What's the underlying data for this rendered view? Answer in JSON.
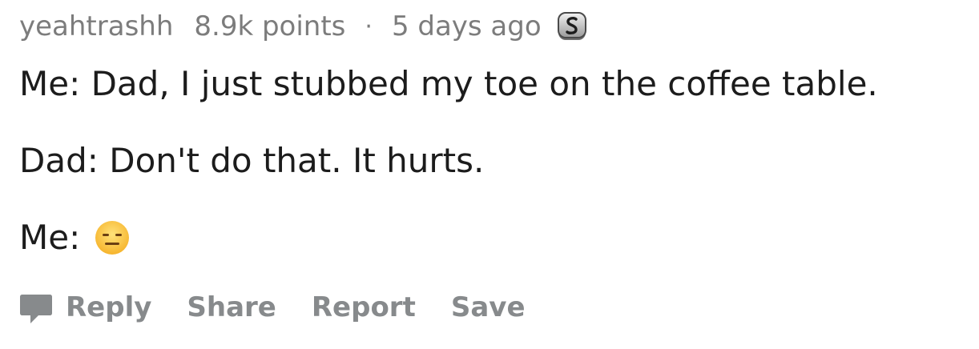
{
  "comment": {
    "author": "yeahtrashh",
    "points": "8.9k points",
    "separator": "·",
    "age": "5 days ago",
    "badge_icon": "silver-award-icon",
    "lines": [
      "Me: Dad, I just stubbed my toe on the coffee table.",
      "Dad: Don't do that. It hurts.",
      "Me:"
    ],
    "emoji_icon": "expressionless-face-icon"
  },
  "actions": {
    "reply_icon": "comment-bubble-icon",
    "reply_label": "Reply",
    "share_label": "Share",
    "report_label": "Report",
    "save_label": "Save"
  },
  "colors": {
    "meta": "#7c7c7c",
    "body": "#1c1c1c",
    "action": "#878a8c"
  }
}
